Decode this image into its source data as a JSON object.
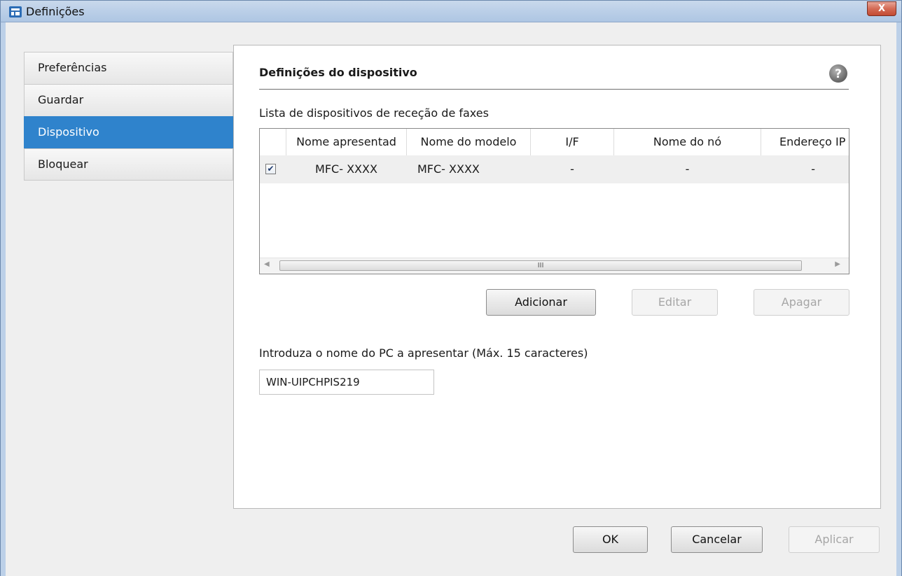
{
  "window": {
    "title": "Definições",
    "close_symbol": "X"
  },
  "sidebar": {
    "items": [
      {
        "label": "Preferências",
        "active": false
      },
      {
        "label": "Guardar",
        "active": false
      },
      {
        "label": "Dispositivo",
        "active": true
      },
      {
        "label": "Bloquear",
        "active": false
      }
    ]
  },
  "panel": {
    "title": "Definições do dispositivo",
    "help_icon": "question-mark-icon",
    "list_label": "Lista de dispositivos de receção de faxes",
    "table": {
      "columns": [
        "Nome apresentad",
        "Nome do modelo",
        "I/F",
        "Nome do nó",
        "Endereço IP"
      ],
      "rows": [
        {
          "checked": true,
          "cells": [
            "MFC- XXXX",
            "MFC- XXXX",
            "-",
            "-",
            "-"
          ]
        }
      ],
      "scroll_thumb_text": "III"
    },
    "buttons": {
      "add": "Adicionar",
      "edit": "Editar",
      "delete": "Apagar"
    },
    "pc_name_label": "Introduza o nome do PC a apresentar (Máx. 15 caracteres)",
    "pc_name_value": "WIN-UIPCHPIS219"
  },
  "footer": {
    "ok": "OK",
    "cancel": "Cancelar",
    "apply": "Aplicar"
  },
  "colors": {
    "accent": "#2f83cc",
    "title_bar": "#bcd0e8",
    "close": "#c9513b"
  }
}
